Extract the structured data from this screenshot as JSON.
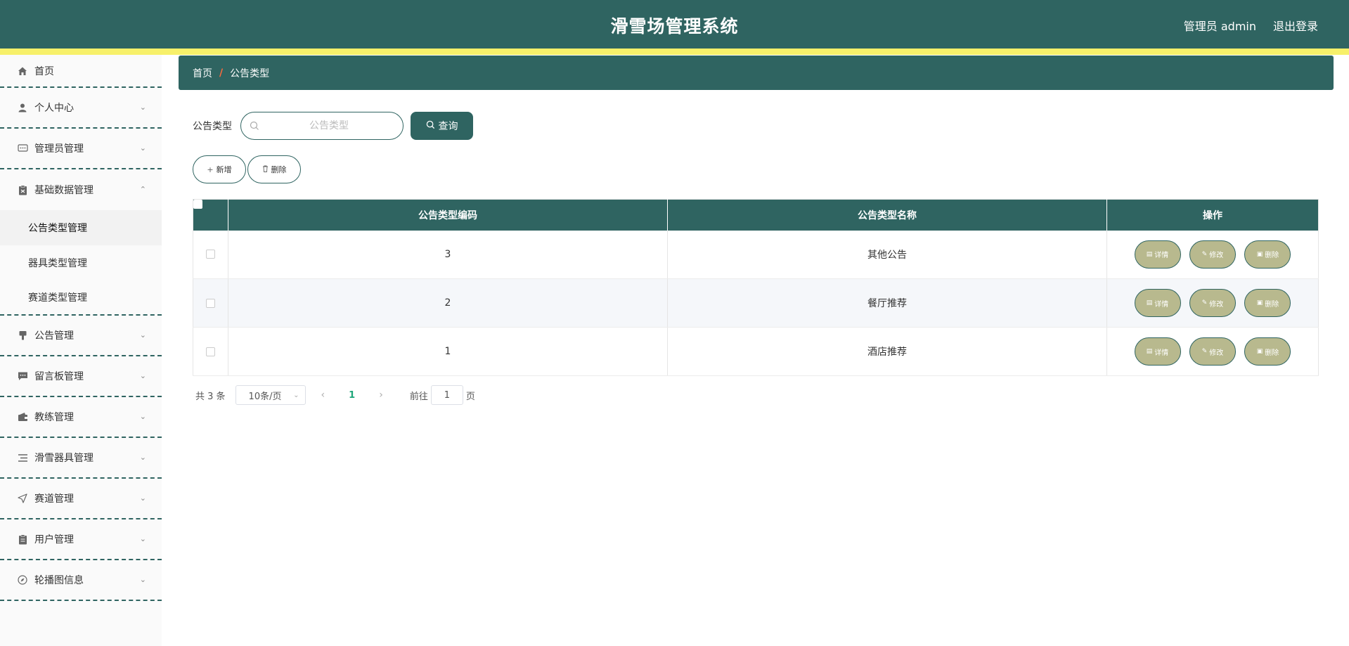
{
  "header": {
    "title": "滑雪场管理系统",
    "user": "管理员 admin",
    "logout": "退出登录"
  },
  "sidebar": {
    "items": [
      {
        "label": "首页",
        "icon": "home-icon"
      },
      {
        "label": "个人中心",
        "icon": "user-icon"
      },
      {
        "label": "管理员管理",
        "icon": "chat-icon"
      },
      {
        "label": "基础数据管理",
        "icon": "clipboard-icon",
        "expanded": true,
        "children": [
          "公告类型管理",
          "器具类型管理",
          "赛道类型管理"
        ]
      },
      {
        "label": "公告管理",
        "icon": "brush-icon"
      },
      {
        "label": "留言板管理",
        "icon": "message-icon"
      },
      {
        "label": "教练管理",
        "icon": "wallet-icon"
      },
      {
        "label": "滑雪器具管理",
        "icon": "list-icon"
      },
      {
        "label": "赛道管理",
        "icon": "send-icon"
      },
      {
        "label": "用户管理",
        "icon": "document-icon"
      },
      {
        "label": "轮播图信息",
        "icon": "compass-icon"
      }
    ]
  },
  "breadcrumb": {
    "home": "首页",
    "separator": "/",
    "current": "公告类型"
  },
  "search": {
    "label": "公告类型",
    "placeholder": "公告类型",
    "query_button": "查询"
  },
  "actions": {
    "add": "新增",
    "delete": "删除"
  },
  "table": {
    "columns": [
      "公告类型编码",
      "公告类型名称",
      "操作"
    ],
    "rows": [
      {
        "code": "3",
        "name": "其他公告"
      },
      {
        "code": "2",
        "name": "餐厅推荐"
      },
      {
        "code": "1",
        "name": "酒店推荐"
      }
    ],
    "op_detail": "详情",
    "op_edit": "修改",
    "op_delete": "删除"
  },
  "pagination": {
    "total": "共 3 条",
    "page_size": "10条/页",
    "current_page": "1",
    "goto_prefix": "前往",
    "goto_value": "1",
    "goto_suffix": "页"
  },
  "colors": {
    "primary": "#2f6461",
    "accent_stripe": "#f7f06a",
    "op_button": "#b8b98e"
  }
}
